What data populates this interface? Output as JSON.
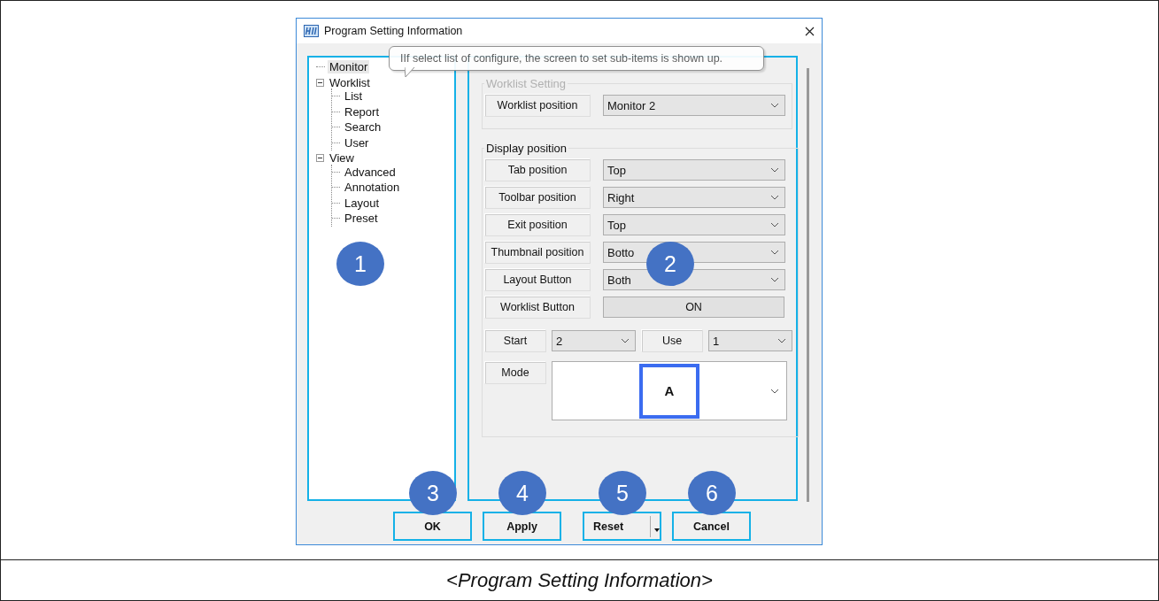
{
  "window": {
    "title": "Program Setting Information"
  },
  "tree": {
    "callout": "1",
    "items": [
      {
        "label": "Monitor",
        "selected": true
      },
      {
        "label": "Worklist",
        "selected": false,
        "expanded": true,
        "children": [
          {
            "label": "List",
            "selected": false
          },
          {
            "label": "Report",
            "selected": false
          },
          {
            "label": "Search",
            "selected": false
          },
          {
            "label": "User",
            "selected": false
          }
        ]
      },
      {
        "label": "View",
        "selected": false,
        "expanded": true,
        "children": [
          {
            "label": "Advanced",
            "selected": false
          },
          {
            "label": "Annotation",
            "selected": false
          },
          {
            "label": "Layout",
            "selected": false
          },
          {
            "label": "Preset",
            "selected": false
          }
        ]
      }
    ]
  },
  "tooltip": "IIf select list of configure, the screen to set sub-items is shown up.",
  "settings": {
    "callout": "2",
    "worklist_setting": {
      "title": "Worklist Setting",
      "fields": [
        {
          "label": "Worklist position",
          "kind": "select",
          "value": "Monitor 2"
        }
      ]
    },
    "display_position": {
      "title": "Display position",
      "fields": [
        {
          "label": "Tab position",
          "kind": "select",
          "value": "Top"
        },
        {
          "label": "Toolbar position",
          "kind": "select",
          "value": "Right"
        },
        {
          "label": "Exit position",
          "kind": "select",
          "value": "Top"
        },
        {
          "label": "Thumbnail position",
          "kind": "select",
          "value": "Botto"
        },
        {
          "label": "Layout Button",
          "kind": "select",
          "value": "Both"
        },
        {
          "label": "Worklist Button",
          "kind": "toggle",
          "value": "ON"
        }
      ],
      "pairs": [
        {
          "label": "Start",
          "value": "2"
        },
        {
          "label": "Use",
          "value": "1"
        }
      ],
      "mode": {
        "label": "Mode",
        "value": "A"
      }
    }
  },
  "buttons": [
    {
      "label": "OK",
      "kind": "plain",
      "callout": "3"
    },
    {
      "label": "Apply",
      "kind": "plain",
      "callout": "4"
    },
    {
      "label": "Reset",
      "kind": "split",
      "callout": "5"
    },
    {
      "label": "Cancel",
      "kind": "plain",
      "callout": "6"
    }
  ],
  "caption": "<Program Setting Information>"
}
